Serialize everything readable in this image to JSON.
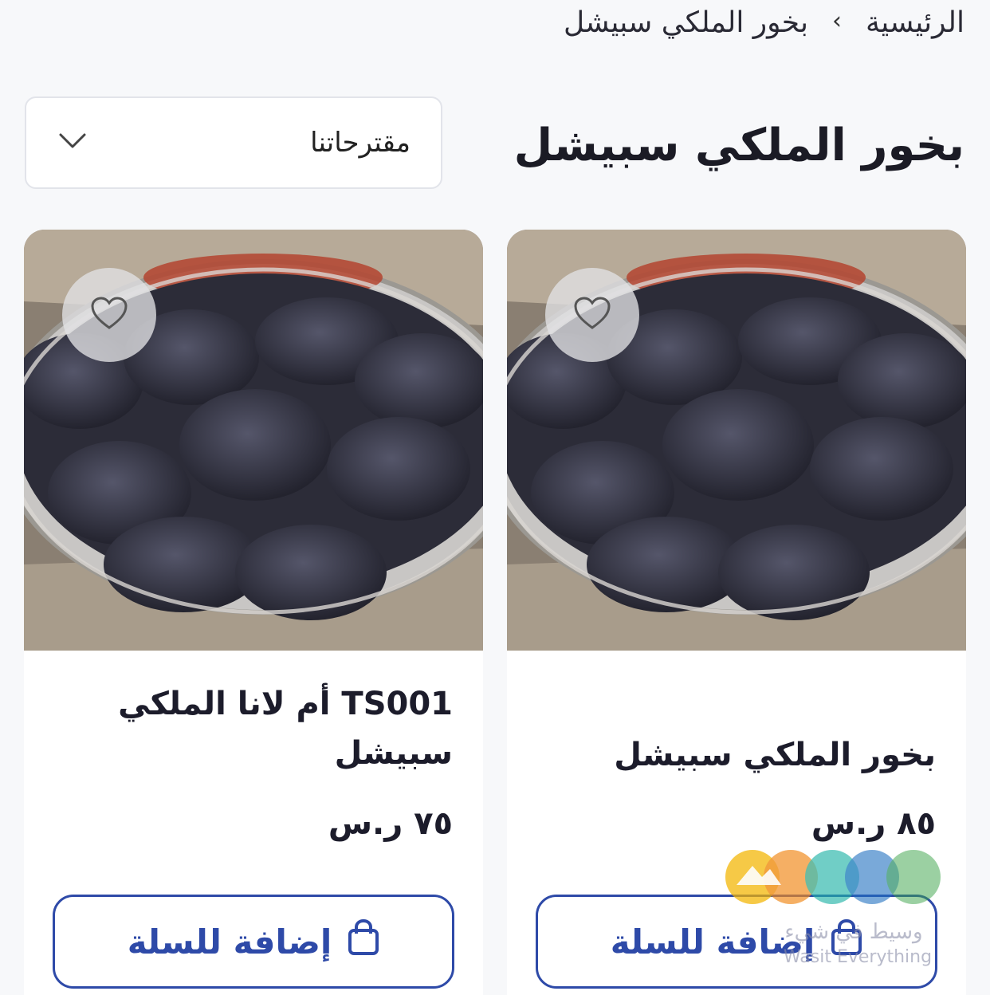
{
  "breadcrumb": {
    "home": "الرئيسية",
    "current": "بخور الملكي سبيشل"
  },
  "page_title": "بخور الملكي سبيشل",
  "sort": {
    "selected": "مقترحاتنا"
  },
  "products": [
    {
      "name": "بخور الملكي سبيشل",
      "price": "٨٥ ر.س",
      "add_to_cart": "إضافة للسلة"
    },
    {
      "name": "TS001 أم لانا الملكي سبيشل",
      "price": "٧٥ ر.س",
      "add_to_cart": "إضافة للسلة"
    }
  ],
  "watermark": {
    "text": "وسيط في شيء",
    "sub": "Wasit Everything"
  },
  "colors": {
    "accent": "#2e4aa8",
    "background": "#f7f8fa"
  }
}
